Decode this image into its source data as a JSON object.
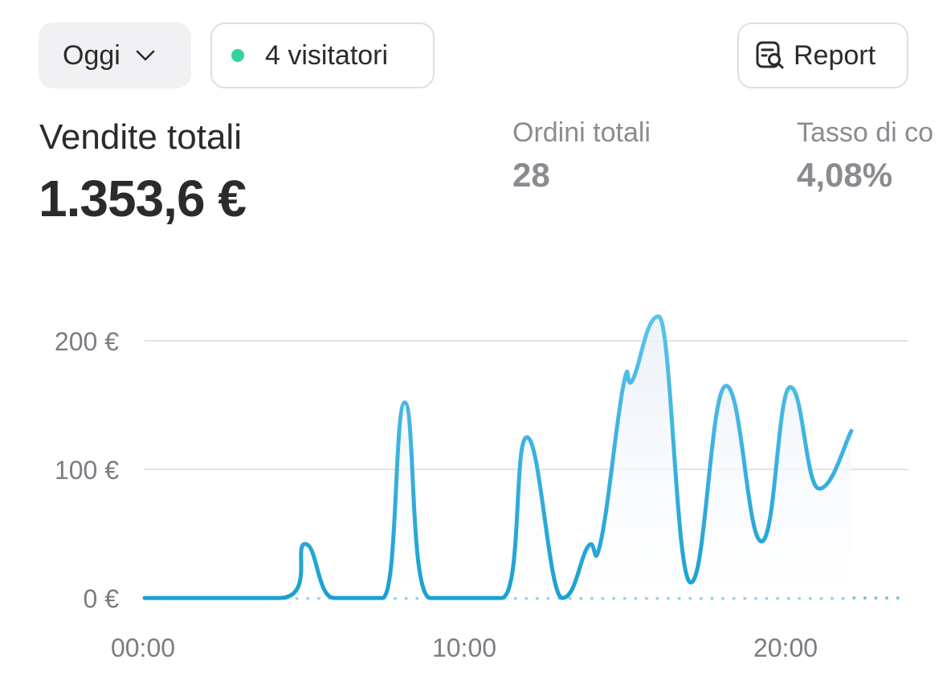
{
  "toolbar": {
    "date_filter_label": "Oggi",
    "visitors_label": "4 visitatori",
    "live_status_color": "#34d399",
    "report_label": "Report"
  },
  "summary": {
    "total_sales_label": "Vendite totali",
    "total_sales_value": "1.353,6 €",
    "total_orders_label": "Ordini totali",
    "total_orders_value": "28",
    "conversion_label": "Tasso di co",
    "conversion_value": "4,08%"
  },
  "colors": {
    "line": "#1aa0d2",
    "line_light": "#5cc3ea",
    "grid": "#e3e3e6",
    "dotted_baseline": "#7cc4dd"
  },
  "chart_data": {
    "type": "area",
    "title": "",
    "xlabel": "",
    "ylabel": "",
    "x_tick_labels": [
      "00:00",
      "10:00",
      "20:00"
    ],
    "y_tick_labels": [
      "0 €",
      "100 €",
      "200 €"
    ],
    "ylim": [
      0,
      240
    ],
    "xlim": [
      0,
      23.5
    ],
    "grid": true,
    "series": [
      {
        "points": [
          [
            0,
            0
          ],
          [
            4.2,
            0
          ],
          [
            5.0,
            42
          ],
          [
            5.9,
            0
          ],
          [
            7.4,
            0
          ],
          [
            8.1,
            152
          ],
          [
            8.9,
            0
          ],
          [
            11.1,
            0
          ],
          [
            11.9,
            125
          ],
          [
            13.0,
            0
          ],
          [
            13.8,
            40
          ],
          [
            14.2,
            44
          ],
          [
            14.9,
            165
          ],
          [
            15.2,
            170
          ],
          [
            16.0,
            219
          ],
          [
            17.0,
            12
          ],
          [
            18.1,
            165
          ],
          [
            19.2,
            44
          ],
          [
            20.1,
            164
          ],
          [
            21.0,
            85
          ],
          [
            22.0,
            130
          ]
        ]
      }
    ],
    "projection_series": {
      "from": 4.2,
      "to": 23.5,
      "value": 0,
      "style": "dotted"
    }
  }
}
